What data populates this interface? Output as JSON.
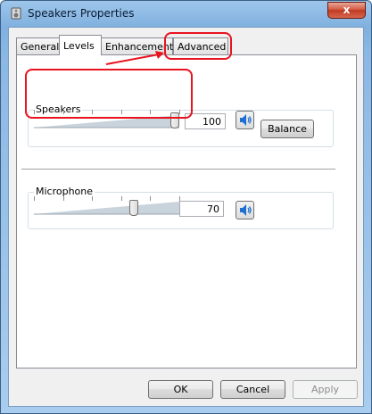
{
  "window": {
    "title": "Speakers Properties",
    "close_glyph": "x"
  },
  "tabs": [
    {
      "label": "General",
      "active": false
    },
    {
      "label": "Levels",
      "active": true
    },
    {
      "label": "Enhancements",
      "active": false
    },
    {
      "label": "Advanced",
      "active": false
    }
  ],
  "speakers": {
    "label": "Speakers",
    "value": "100",
    "level": 1.0,
    "balance_label": "Balance",
    "icon": "speaker-icon"
  },
  "microphone": {
    "label": "Microphone",
    "value": "70",
    "level": 0.7,
    "icon": "speaker-icon"
  },
  "footer": {
    "ok_label": "OK",
    "cancel_label": "Cancel",
    "apply_label": "Apply"
  },
  "colors": {
    "annotation": "#e8131f",
    "accent": "#1f6fd0"
  }
}
